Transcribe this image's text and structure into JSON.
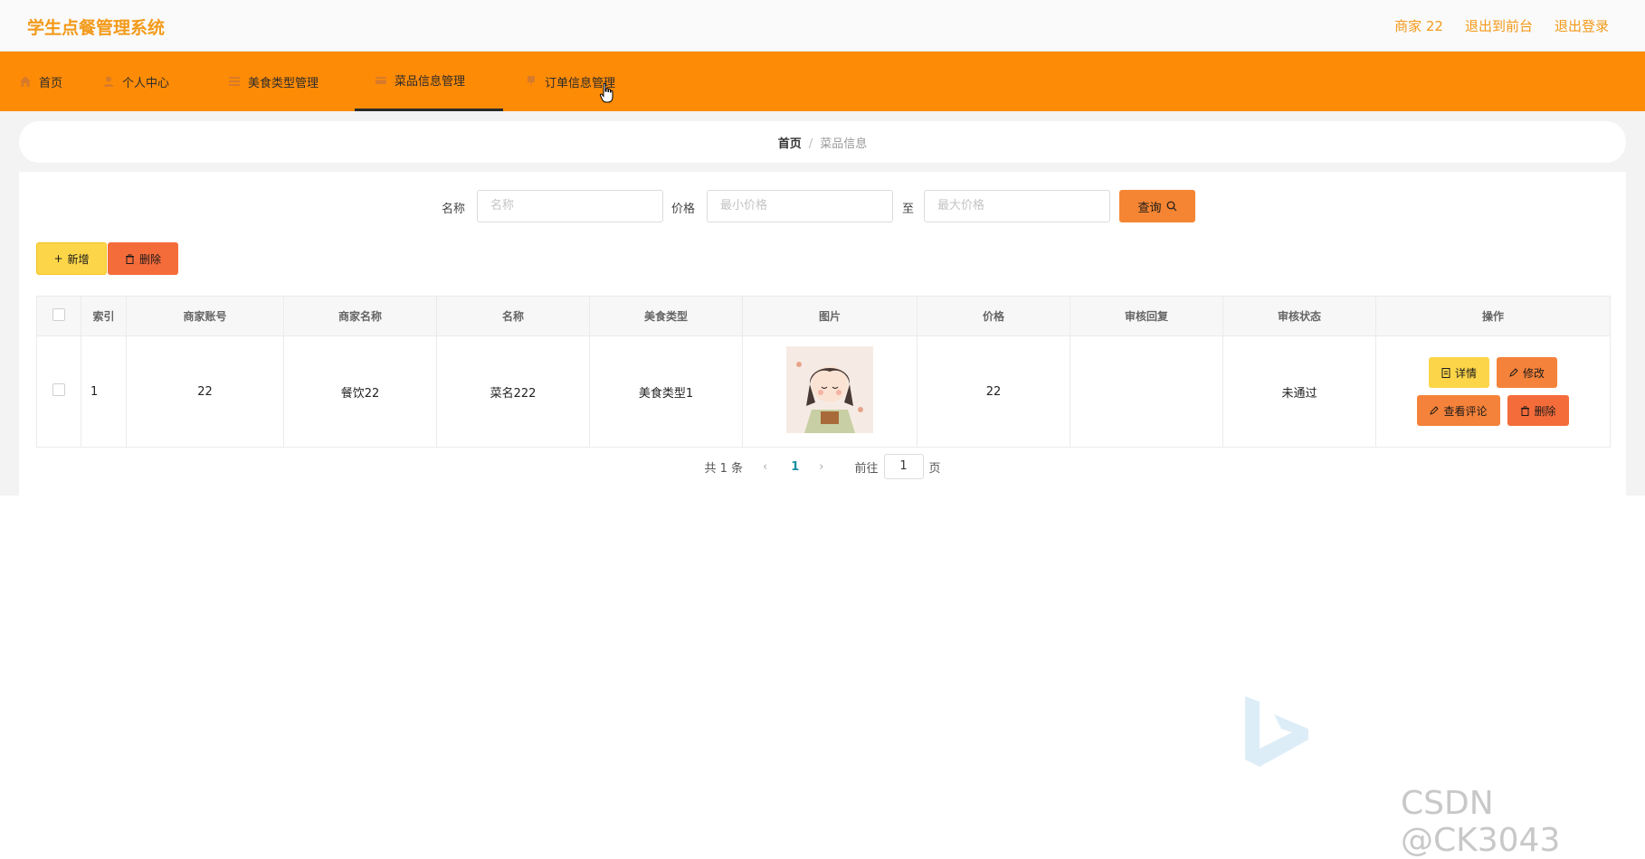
{
  "app": {
    "title": "学生点餐管理系统"
  },
  "top_links": [
    "商家 22",
    "退出到前台",
    "退出登录"
  ],
  "nav": [
    {
      "label": "首页",
      "icon": "home-icon"
    },
    {
      "label": "个人中心",
      "icon": "user-icon"
    },
    {
      "label": "美食类型管理",
      "icon": "list-icon"
    },
    {
      "label": "菜品信息管理",
      "icon": "card-icon",
      "active": true
    },
    {
      "label": "订单信息管理",
      "icon": "pin-icon"
    }
  ],
  "breadcrumb": {
    "home": "首页",
    "sep": "/",
    "current": "菜品信息"
  },
  "filter": {
    "name_label": "名称",
    "name_placeholder": "名称",
    "price_label": "价格",
    "min_placeholder": "最小价格",
    "to_label": "至",
    "max_placeholder": "最大价格",
    "query_label": "查询"
  },
  "actions": {
    "add": "新增",
    "delete": "删除"
  },
  "table": {
    "headers": [
      "",
      "索引",
      "商家账号",
      "商家名称",
      "名称",
      "美食类型",
      "图片",
      "价格",
      "审核回复",
      "审核状态",
      "操作"
    ],
    "rows": [
      {
        "index": "1",
        "account": "22",
        "merchant": "餐饮22",
        "name": "菜名222",
        "type": "美食类型1",
        "price": "22",
        "reply": "",
        "status": "未通过"
      }
    ],
    "ops": {
      "detail": "详情",
      "edit": "修改",
      "comment": "查看评论",
      "delete": "删除"
    }
  },
  "pager": {
    "total": "共 1 条",
    "prev": "‹",
    "page": "1",
    "next": "›",
    "goto": "前往",
    "goto_value": "1",
    "unit": "页"
  },
  "watermark": "CSDN @CK3043",
  "colors": {
    "accent": "#fe8b06",
    "brand": "#f39a1a",
    "yellow": "#fcd549",
    "orange": "#f5823a",
    "red": "#f56c3b"
  }
}
